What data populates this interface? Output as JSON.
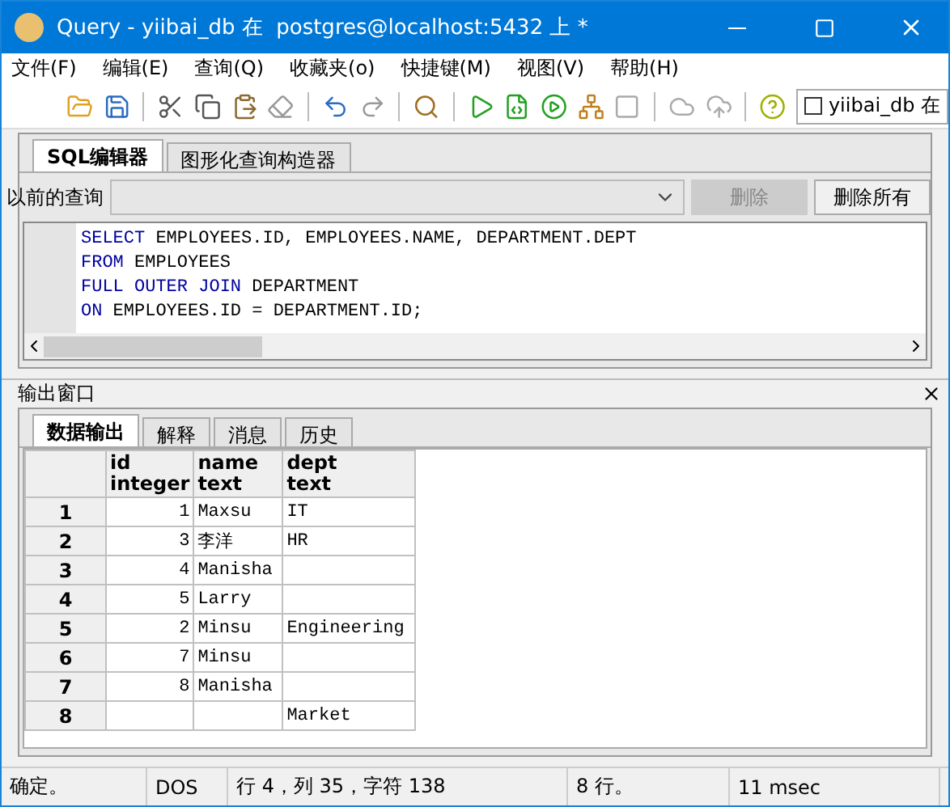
{
  "window": {
    "title": "Query - yiibai_db 在  postgres@localhost:5432 上 *"
  },
  "menu": [
    "文件(F)",
    "编辑(E)",
    "查询(Q)",
    "收藏夹(o)",
    "快捷键(M)",
    "视图(V)",
    "帮助(H)"
  ],
  "toolbar": {
    "connection": {
      "label": "yiibai_db 在",
      "checked": false
    }
  },
  "editor_tabs": [
    {
      "label": "SQL编辑器",
      "selected": true
    },
    {
      "label": "图形化查询构造器",
      "selected": false
    }
  ],
  "previous_query": {
    "label": "以前的查询",
    "buttons": [
      {
        "label": "删除",
        "disabled": true
      },
      {
        "label": "删除所有",
        "disabled": false
      }
    ]
  },
  "sql_lines": [
    [
      {
        "text": "SELECT",
        "kind": "keyword"
      },
      {
        "text": " EMPLOYEES.ID, EMPLOYEES.NAME, DEPARTMENT.DEPT",
        "kind": "plain"
      }
    ],
    [
      {
        "text": "FROM",
        "kind": "keyword"
      },
      {
        "text": " EMPLOYEES",
        "kind": "plain"
      }
    ],
    [
      {
        "text": "FULL OUTER JOIN",
        "kind": "keyword"
      },
      {
        "text": " DEPARTMENT",
        "kind": "plain"
      }
    ],
    [
      {
        "text": "ON",
        "kind": "keyword"
      },
      {
        "text": " EMPLOYEES.ID = DEPARTMENT.ID;",
        "kind": "plain"
      }
    ]
  ],
  "output": {
    "title": "输出窗口",
    "tabs": [
      {
        "label": "数据输出",
        "selected": true
      },
      {
        "label": "解释",
        "selected": false
      },
      {
        "label": "消息",
        "selected": false
      },
      {
        "label": "历史",
        "selected": false
      }
    ],
    "columns": [
      {
        "name": "id",
        "type": "integer"
      },
      {
        "name": "name",
        "type": "text"
      },
      {
        "name": "dept",
        "type": "text"
      }
    ],
    "rows": [
      {
        "num": "1",
        "id": "1",
        "name": "Maxsu",
        "dept": "IT"
      },
      {
        "num": "2",
        "id": "3",
        "name": "李洋",
        "dept": "HR"
      },
      {
        "num": "3",
        "id": "4",
        "name": "Manisha"
      },
      {
        "num": "4",
        "id": "5",
        "name": "Larry"
      },
      {
        "num": "5",
        "id": "2",
        "name": "Minsu",
        "dept": "Engineering"
      },
      {
        "num": "6",
        "id": "7",
        "name": "Minsu"
      },
      {
        "num": "7",
        "id": "8",
        "name": "Manisha"
      },
      {
        "num": "8",
        "dept": "Market"
      }
    ]
  },
  "status_bar": [
    "确定。",
    "DOS",
    "行 4，列 35，字符 138",
    "8 行。",
    "11 msec"
  ]
}
